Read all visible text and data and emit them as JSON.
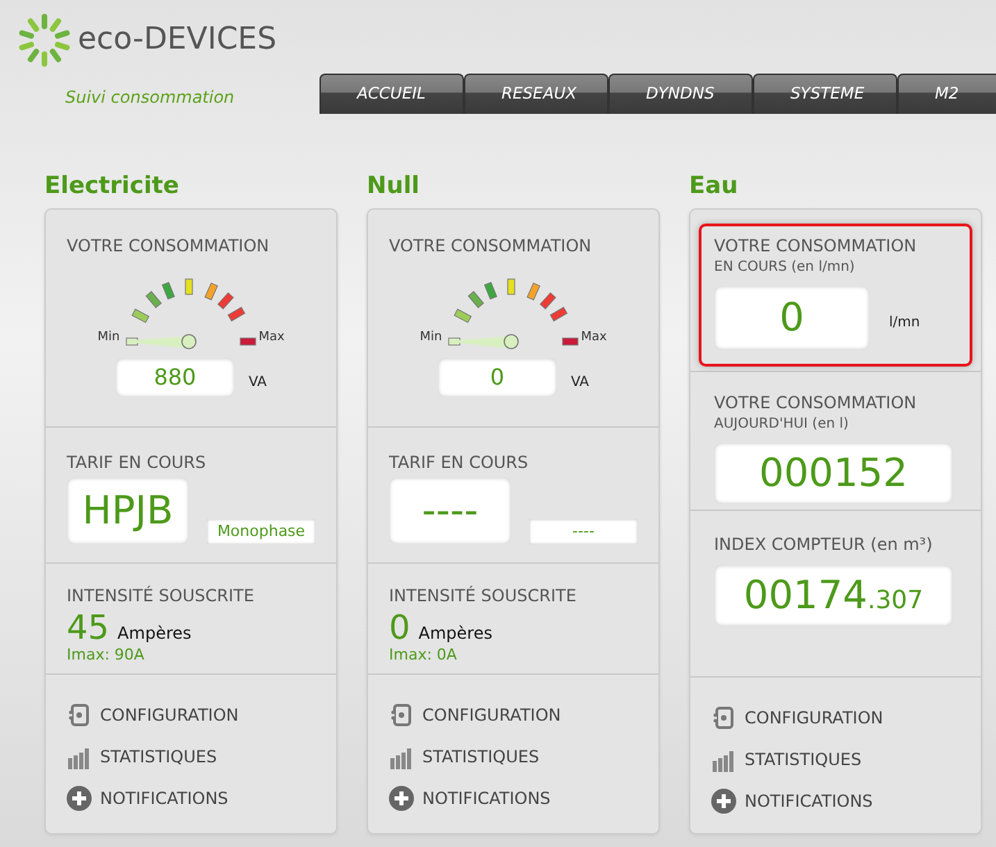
{
  "header": {
    "logo": "eco-DEVICES",
    "tagline": "Suivi consommation"
  },
  "tabs": [
    {
      "label": "ACCUEIL",
      "selected": false
    },
    {
      "label": "RESEAUX",
      "selected": false
    },
    {
      "label": "DYNDNS",
      "selected": false
    },
    {
      "label": "SYSTEME",
      "selected": false
    },
    {
      "label": "M2",
      "selected": false
    }
  ],
  "columns": [
    {
      "title": "Electricite",
      "sections": [
        {
          "kind": "gauge",
          "label": "VOTRE CONSOMMATION",
          "min": "Min",
          "max": "Max",
          "value": "880",
          "unit": "VA"
        },
        {
          "kind": "tarif",
          "label": "TARIF EN COURS",
          "value": "HPJB",
          "mode": "Monophase"
        },
        {
          "kind": "intensity",
          "label": "INTENSITÉ SOUSCRITE",
          "value": "45",
          "unit": "Ampères",
          "imax": "Imax: 90A"
        },
        {
          "kind": "links",
          "items": [
            {
              "label": "CONFIGURATION"
            },
            {
              "label": "STATISTIQUES"
            },
            {
              "label": "NOTIFICATIONS"
            }
          ]
        }
      ]
    },
    {
      "title": "Null",
      "sections": [
        {
          "kind": "gauge",
          "label": "VOTRE CONSOMMATION",
          "min": "Min",
          "max": "Max",
          "value": "0",
          "unit": "VA"
        },
        {
          "kind": "tarif",
          "label": "TARIF EN COURS",
          "value": "----",
          "mode": "----"
        },
        {
          "kind": "intensity",
          "label": "INTENSITÉ SOUSCRITE",
          "value": "0",
          "unit": "Ampères",
          "imax": "Imax: 0A"
        },
        {
          "kind": "links",
          "items": [
            {
              "label": "CONFIGURATION"
            },
            {
              "label": "STATISTIQUES"
            },
            {
              "label": "NOTIFICATIONS"
            }
          ]
        }
      ]
    },
    {
      "title": "Eau",
      "sections": [
        {
          "kind": "reading",
          "highlighted": true,
          "label": "VOTRE CONSOMMATION",
          "sublabel": "EN COURS (en l/mn)",
          "value": "0",
          "unit": "l/mn"
        },
        {
          "kind": "reading",
          "label": "VOTRE CONSOMMATION",
          "sublabel": "AUJOURD'HUI (en l)",
          "value": "000152"
        },
        {
          "kind": "reading",
          "label": "INDEX COMPTEUR (en m³)",
          "value": "00174",
          "decimals": ".307"
        },
        {
          "kind": "links",
          "items": [
            {
              "label": "CONFIGURATION"
            },
            {
              "label": "STATISTIQUES"
            },
            {
              "label": "NOTIFICATIONS"
            }
          ]
        }
      ]
    }
  ]
}
